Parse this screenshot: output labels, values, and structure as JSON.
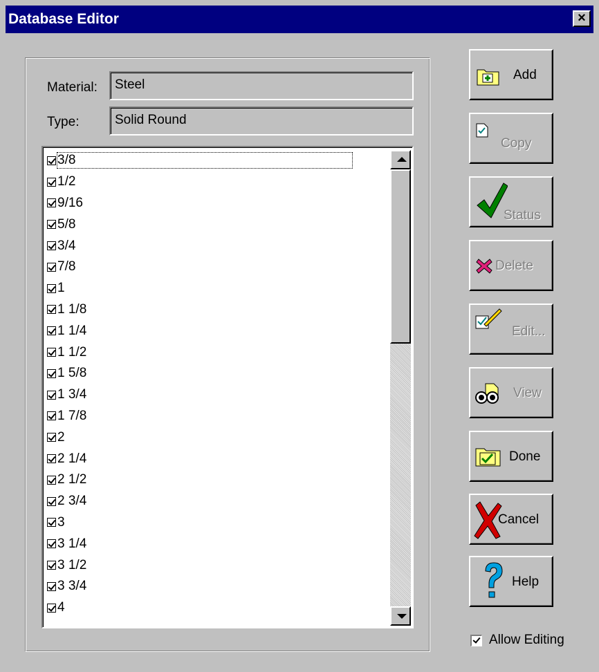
{
  "window": {
    "title": "Database Editor",
    "close_glyph": "×"
  },
  "form": {
    "material_label": "Material:",
    "material_value": "Steel",
    "type_label": "Type:",
    "type_value": "Solid Round"
  },
  "list": {
    "items": [
      "3/8",
      "1/2",
      "9/16",
      "5/8",
      "3/4",
      "7/8",
      "1",
      "1 1/8",
      "1 1/4",
      "1 1/2",
      "1 5/8",
      "1 3/4",
      "1 7/8",
      "2",
      "2 1/4",
      "2 1/2",
      "2 3/4",
      "3",
      "3 1/4",
      "3 1/2",
      "3 3/4",
      "4"
    ]
  },
  "buttons": {
    "add": "Add",
    "copy": "Copy",
    "status": "Status",
    "delete": "Delete",
    "edit": "Edit...",
    "view": "View",
    "done": "Done",
    "cancel": "Cancel",
    "help": "Help"
  },
  "allow_editing": {
    "label": "Allow Editing",
    "checked": true
  },
  "icons": [
    "add-folder-icon",
    "copy-icon",
    "checkmark-icon",
    "delete-x-icon",
    "edit-pencil-icon",
    "binoculars-icon",
    "done-folder-icon",
    "cancel-x-icon",
    "help-question-icon"
  ],
  "colors": {
    "titlebar": "#000080",
    "face": "#c0c0c0",
    "disabled_text": "#808080"
  }
}
